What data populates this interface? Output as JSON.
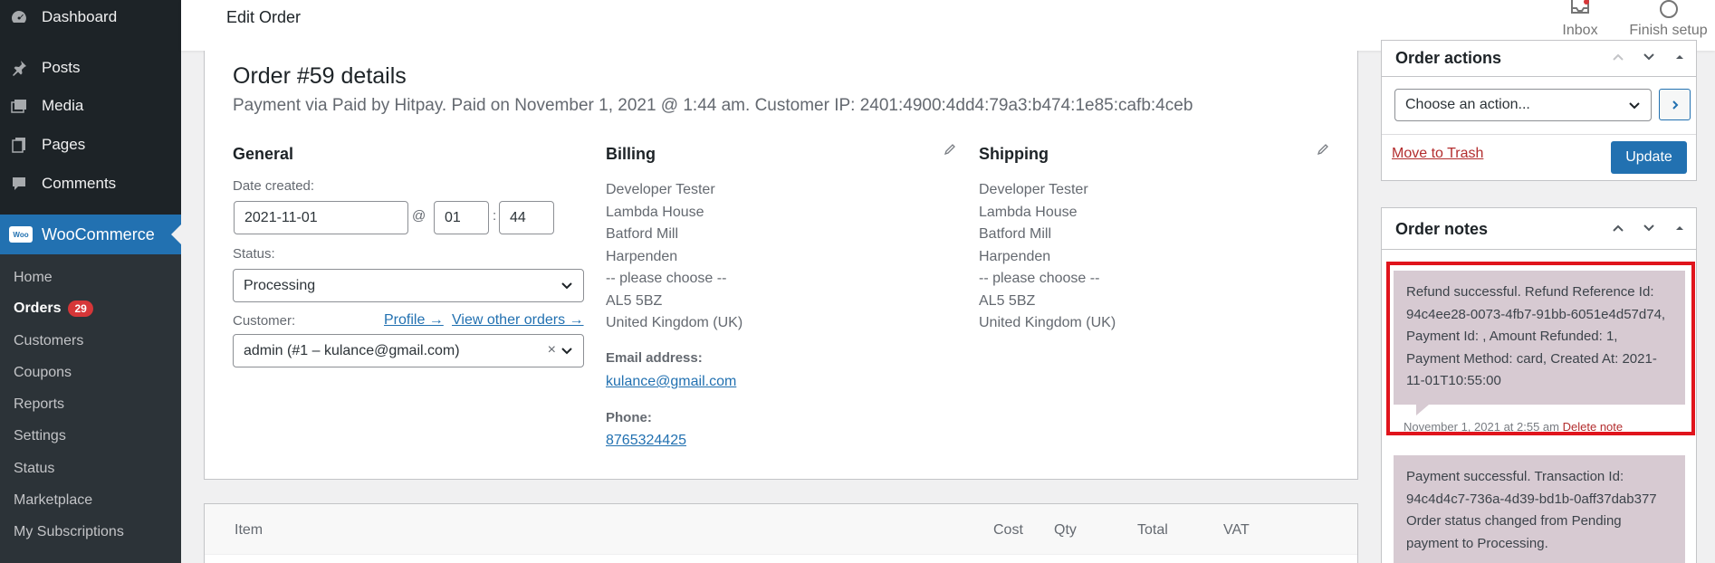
{
  "sidebar": {
    "items": [
      {
        "label": "Dashboard",
        "icon": "dashboard-icon"
      },
      {
        "label": "Posts",
        "icon": "pin-icon"
      },
      {
        "label": "Media",
        "icon": "media-icon"
      },
      {
        "label": "Pages",
        "icon": "pages-icon"
      },
      {
        "label": "Comments",
        "icon": "comment-icon"
      }
    ],
    "woocommerce": "WooCommerce",
    "woo_logo": "Woo",
    "submenu": [
      {
        "label": "Home"
      },
      {
        "label": "Orders",
        "badge": "29"
      },
      {
        "label": "Customers"
      },
      {
        "label": "Coupons"
      },
      {
        "label": "Reports"
      },
      {
        "label": "Settings"
      },
      {
        "label": "Status"
      },
      {
        "label": "Marketplace"
      },
      {
        "label": "My Subscriptions"
      }
    ]
  },
  "topbar": {
    "title": "Edit Order",
    "inbox": "Inbox",
    "finish_setup": "Finish setup"
  },
  "order": {
    "title": "Order #59 details",
    "subtitle": "Payment via Paid by Hitpay. Paid on November 1, 2021 @ 1:44 am. Customer IP: 2401:4900:4dd4:79a3:b474:1e85:cafb:4ceb",
    "general": {
      "heading": "General",
      "date_label": "Date created:",
      "date": "2021-11-01",
      "at": "@",
      "hour": "01",
      "colon": ":",
      "minute": "44",
      "status_label": "Status:",
      "status": "Processing",
      "customer_label": "Customer:",
      "profile_link": "Profile →",
      "other_orders_link": "View other orders →",
      "customer": "admin (#1 – kulance@gmail.com)",
      "clear": "×"
    },
    "billing": {
      "heading": "Billing",
      "lines": [
        "Developer Tester",
        "Lambda House",
        "Batford Mill",
        "Harpenden",
        "-- please choose --",
        "AL5 5BZ",
        "United Kingdom (UK)"
      ],
      "email_label": "Email address:",
      "email": "kulance@gmail.com",
      "phone_label": "Phone:",
      "phone": "8765324425"
    },
    "shipping": {
      "heading": "Shipping",
      "lines": [
        "Developer Tester",
        "Lambda House",
        "Batford Mill",
        "Harpenden",
        "-- please choose --",
        "AL5 5BZ",
        "United Kingdom (UK)"
      ]
    }
  },
  "items_table": {
    "headers": {
      "item": "Item",
      "cost": "Cost",
      "qty": "Qty",
      "total": "Total",
      "vat": "VAT"
    }
  },
  "order_actions": {
    "title": "Order actions",
    "select": "Choose an action...",
    "trash": "Move to Trash",
    "update": "Update"
  },
  "order_notes": {
    "title": "Order notes",
    "notes": [
      {
        "text": "Refund successful. Refund Reference Id: 94c4ee28-0073-4fb7-91bb-6051e4d57d74, Payment Id: , Amount Refunded: 1, Payment Method: card, Created At: 2021-11-01T10:55:00",
        "date": "November 1, 2021 at 2:55 am",
        "delete": "Delete note"
      },
      {
        "text": "Payment successful. Transaction Id: 94c4d4c7-736a-4d39-bd1b-0aff37dab377 Order status changed from Pending payment to Processing."
      }
    ]
  },
  "colors": {
    "sidebar_bg": "#1d2327",
    "accent": "#2271b1",
    "note_bg": "#d7cad2",
    "highlight": "#e0141c",
    "badge": "#d63638"
  }
}
